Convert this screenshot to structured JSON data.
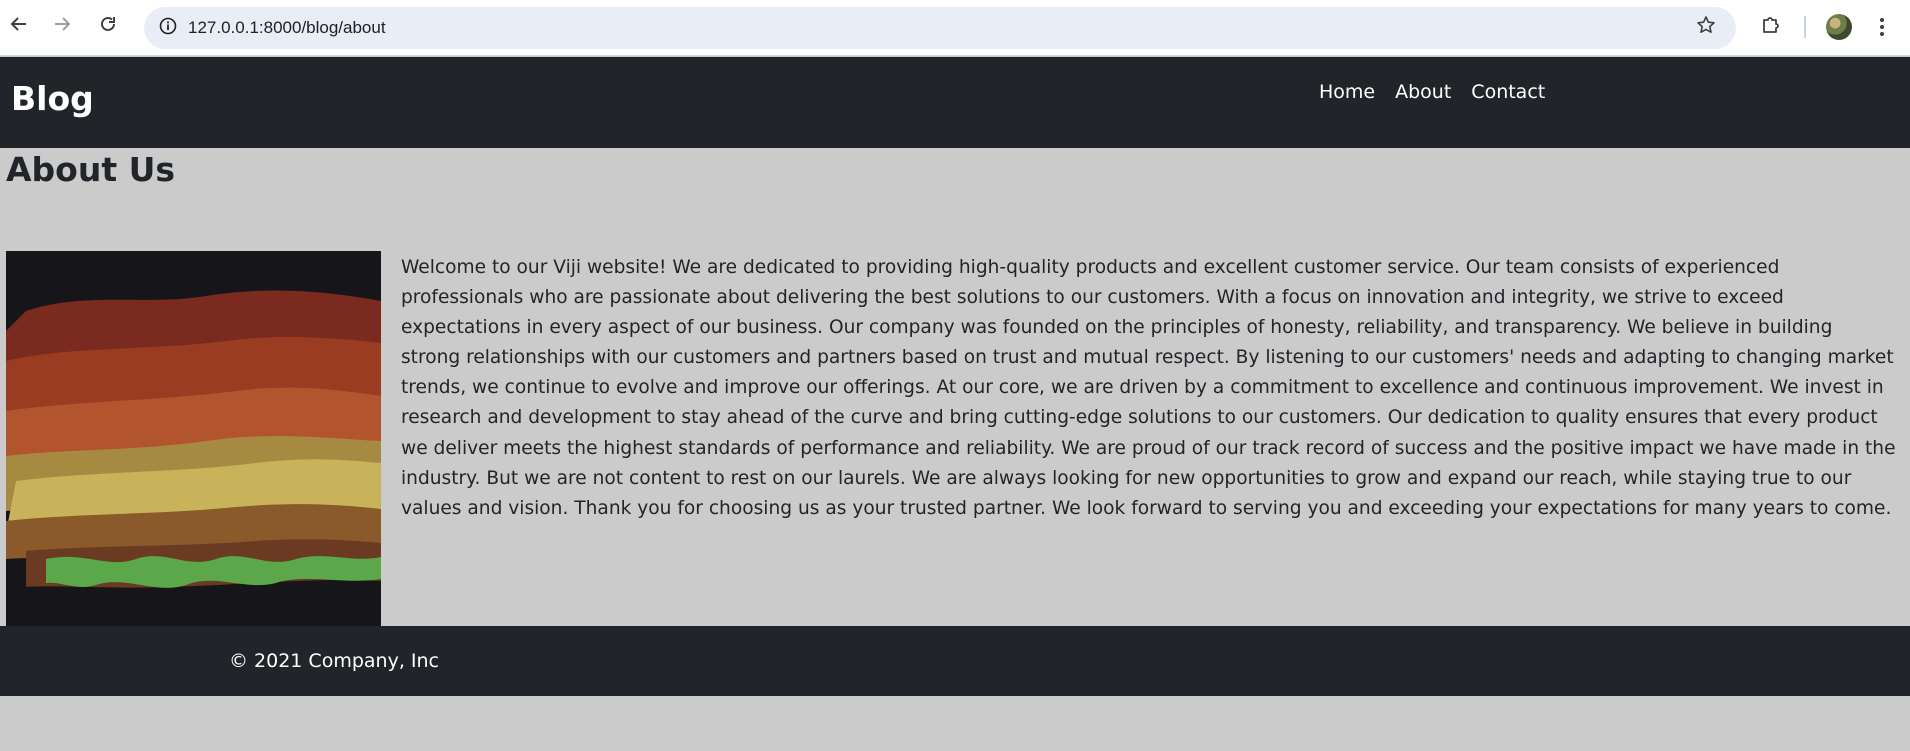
{
  "browser": {
    "url": "127.0.0.1:8000/blog/about",
    "icons": {
      "back": "arrow-left-icon",
      "forward": "arrow-right-icon",
      "reload": "reload-icon",
      "site_info": "info-icon",
      "bookmark": "star-icon",
      "extensions": "puzzle-icon",
      "menu": "kebab-menu-icon"
    }
  },
  "header": {
    "brand": "Blog",
    "nav": [
      {
        "label": "Home"
      },
      {
        "label": "About"
      },
      {
        "label": "Contact"
      }
    ]
  },
  "main": {
    "title": "About Us",
    "image_subject": "autumn-leaves-photo",
    "paragraph": "Welcome to our Viji website! We are dedicated to providing high-quality products and excellent customer service. Our team consists of experienced professionals who are passionate about delivering the best solutions to our customers. With a focus on innovation and integrity, we strive to exceed expectations in every aspect of our business. Our company was founded on the principles of honesty, reliability, and transparency. We believe in building strong relationships with our customers and partners based on trust and mutual respect. By listening to our customers' needs and adapting to changing market trends, we continue to evolve and improve our offerings. At our core, we are driven by a commitment to excellence and continuous improvement. We invest in research and development to stay ahead of the curve and bring cutting-edge solutions to our customers. Our dedication to quality ensures that every product we deliver meets the highest standards of performance and reliability. We are proud of our track record of success and the positive impact we have made in the industry. But we are not content to rest on our laurels. We are always looking for new opportunities to grow and expand our reach, while staying true to our values and vision. Thank you for choosing us as your trusted partner. We look forward to serving you and exceeding your expectations for many years to come."
  },
  "footer": {
    "copyright": "© 2021 Company, Inc"
  },
  "colors": {
    "page_background": "#cbcbcb",
    "header_background": "#212529",
    "footer_background": "#212529",
    "text": "#212529",
    "omnibox": "#e8edf7"
  }
}
